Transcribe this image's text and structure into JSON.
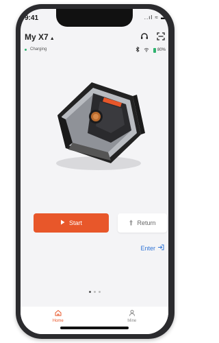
{
  "status_bar": {
    "time": "9:41",
    "icons": "..ıl ≈ ▬"
  },
  "header": {
    "title": "My X7",
    "caret": "▲"
  },
  "device": {
    "status": "Charging",
    "battery": "80%"
  },
  "actions": {
    "start_label": "Start",
    "return_label": "Return",
    "enter_label": "Enter"
  },
  "tabs": [
    {
      "label": "Home"
    },
    {
      "label": "Mine"
    }
  ],
  "colors": {
    "accent": "#e8572a",
    "link": "#2e73d6",
    "ok": "#2fb36f"
  },
  "pager": {
    "pages": 3,
    "active": 1
  }
}
